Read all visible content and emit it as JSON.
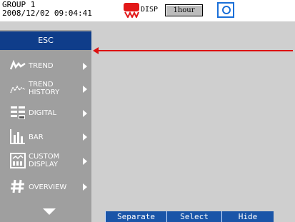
{
  "header": {
    "group_name": "GROUP 1",
    "datetime": "2008/12/02 09:04:41",
    "disp_label": "DISP",
    "interval": "1hour"
  },
  "menu": {
    "esc_label": "ESC",
    "items": [
      {
        "label_line1": "TREND",
        "label_line2": "",
        "icon": "trend-icon"
      },
      {
        "label_line1": "TREND",
        "label_line2": "HISTORY",
        "icon": "trend-history-icon"
      },
      {
        "label_line1": "DIGITAL",
        "label_line2": "",
        "icon": "digital-icon"
      },
      {
        "label_line1": "BAR",
        "label_line2": "",
        "icon": "bar-icon"
      },
      {
        "label_line1": "CUSTOM",
        "label_line2": "DISPLAY",
        "icon": "custom-display-icon"
      },
      {
        "label_line1": "OVERVIEW",
        "label_line2": "",
        "icon": "overview-icon"
      }
    ]
  },
  "softkeys": [
    "Separate",
    "Select",
    "Hide"
  ],
  "colors": {
    "esc_bg": "#0f3d8a",
    "menu_bg": "#9f9f9f",
    "screen_bg": "#cfcfcf",
    "softkey_bg": "#1a55a8",
    "pointer": "#dd1111",
    "monitor_icon": "#1a6fd8"
  }
}
